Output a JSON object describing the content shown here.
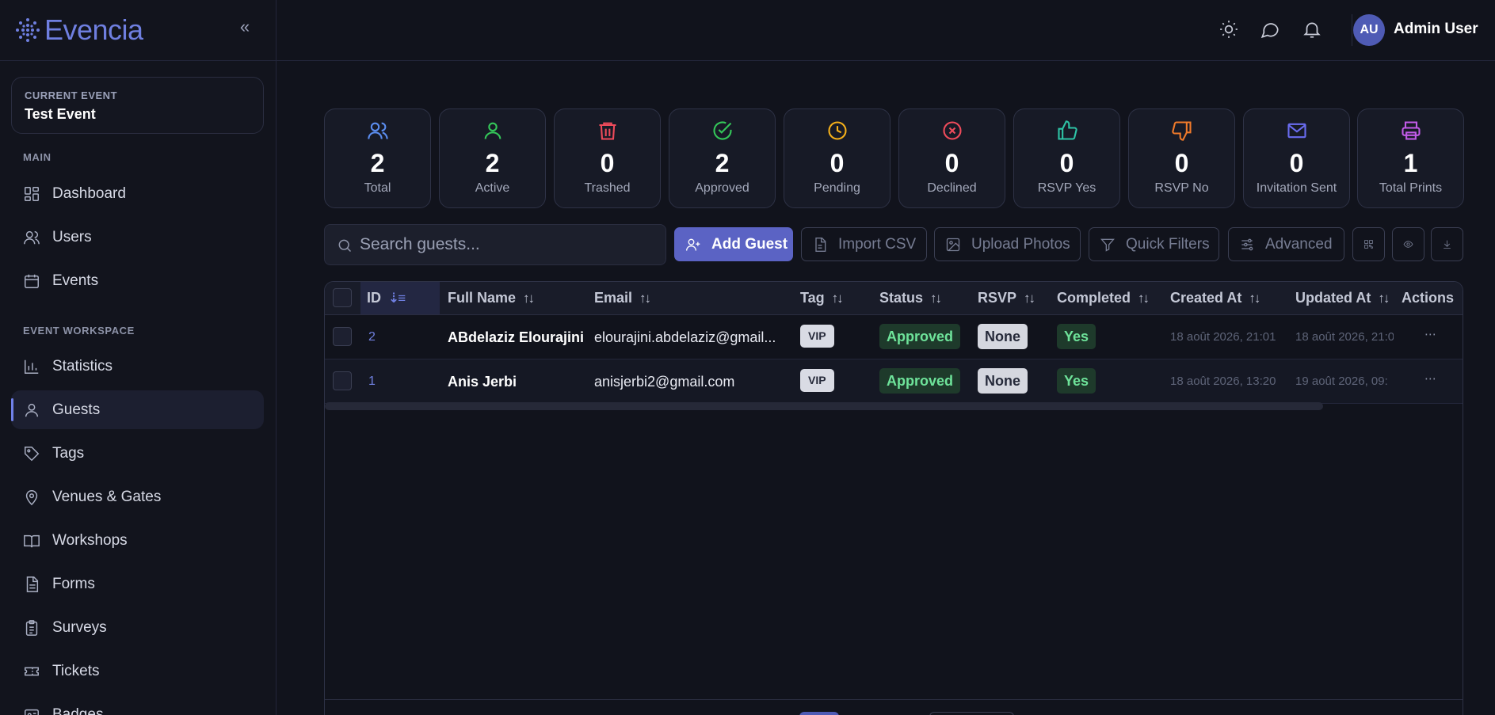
{
  "brand": {
    "name": "Evencia"
  },
  "sidebar": {
    "current_event_label": "CURRENT EVENT",
    "current_event_name": "Test Event",
    "section_main": "MAIN",
    "section_workspace": "EVENT WORKSPACE",
    "main_items": [
      {
        "label": "Dashboard",
        "icon": "dashboard-icon"
      },
      {
        "label": "Users",
        "icon": "users-icon"
      },
      {
        "label": "Events",
        "icon": "calendar-icon"
      }
    ],
    "workspace_items": [
      {
        "label": "Statistics",
        "icon": "chart-icon"
      },
      {
        "label": "Guests",
        "icon": "user-icon",
        "active": true
      },
      {
        "label": "Tags",
        "icon": "tag-icon"
      },
      {
        "label": "Venues & Gates",
        "icon": "map-pin-icon"
      },
      {
        "label": "Workshops",
        "icon": "book-icon"
      },
      {
        "label": "Forms",
        "icon": "form-icon"
      },
      {
        "label": "Surveys",
        "icon": "clipboard-icon"
      },
      {
        "label": "Tickets",
        "icon": "ticket-icon"
      },
      {
        "label": "Badges",
        "icon": "badge-icon"
      }
    ]
  },
  "topbar": {
    "user_initials": "AU",
    "user_name": "Admin User"
  },
  "stats": [
    {
      "value": "2",
      "label": "Total",
      "color": "#5b8def",
      "icon": "users-icon"
    },
    {
      "value": "2",
      "label": "Active",
      "color": "#34c759",
      "icon": "user-check-icon"
    },
    {
      "value": "0",
      "label": "Trashed",
      "color": "#ef4b5b",
      "icon": "trash-icon"
    },
    {
      "value": "2",
      "label": "Approved",
      "color": "#34c759",
      "icon": "check-circle-icon"
    },
    {
      "value": "0",
      "label": "Pending",
      "color": "#f5b01a",
      "icon": "clock-icon"
    },
    {
      "value": "0",
      "label": "Declined",
      "color": "#ef4b5b",
      "icon": "x-circle-icon"
    },
    {
      "value": "0",
      "label": "RSVP Yes",
      "color": "#2ec4a6",
      "icon": "thumbs-up-icon"
    },
    {
      "value": "0",
      "label": "RSVP No",
      "color": "#f07a2a",
      "icon": "thumbs-down-icon"
    },
    {
      "value": "0",
      "label": "Invitation Sent",
      "color": "#6a6cf0",
      "icon": "mail-icon"
    },
    {
      "value": "1",
      "label": "Total Prints",
      "color": "#c25be8",
      "icon": "printer-icon"
    }
  ],
  "toolbar": {
    "search_placeholder": "Search guests...",
    "add_guest": "Add Guest",
    "import_csv": "Import CSV",
    "upload_photos": "Upload Photos",
    "quick_filters": "Quick Filters",
    "advanced": "Advanced"
  },
  "table": {
    "columns": [
      "ID",
      "Full Name",
      "Email",
      "Tag",
      "Status",
      "RSVP",
      "Completed",
      "Created At",
      "Updated At",
      "Actions"
    ],
    "rows": [
      {
        "id": "2",
        "name": "ABdelaziz Elourajini",
        "email": "elourajini.abdelaziz@gmail...",
        "tag": "VIP",
        "status": "Approved",
        "rsvp": "None",
        "completed": "Yes",
        "created": "18 août 2026, 21:01",
        "updated": "18 août 2026, 21:0"
      },
      {
        "id": "1",
        "name": "Anis Jerbi",
        "email": "anisjerbi2@gmail.com",
        "tag": "VIP",
        "status": "Approved",
        "rsvp": "None",
        "completed": "Yes",
        "created": "18 août 2026, 13:20",
        "updated": "19 août 2026, 09:"
      }
    ]
  }
}
